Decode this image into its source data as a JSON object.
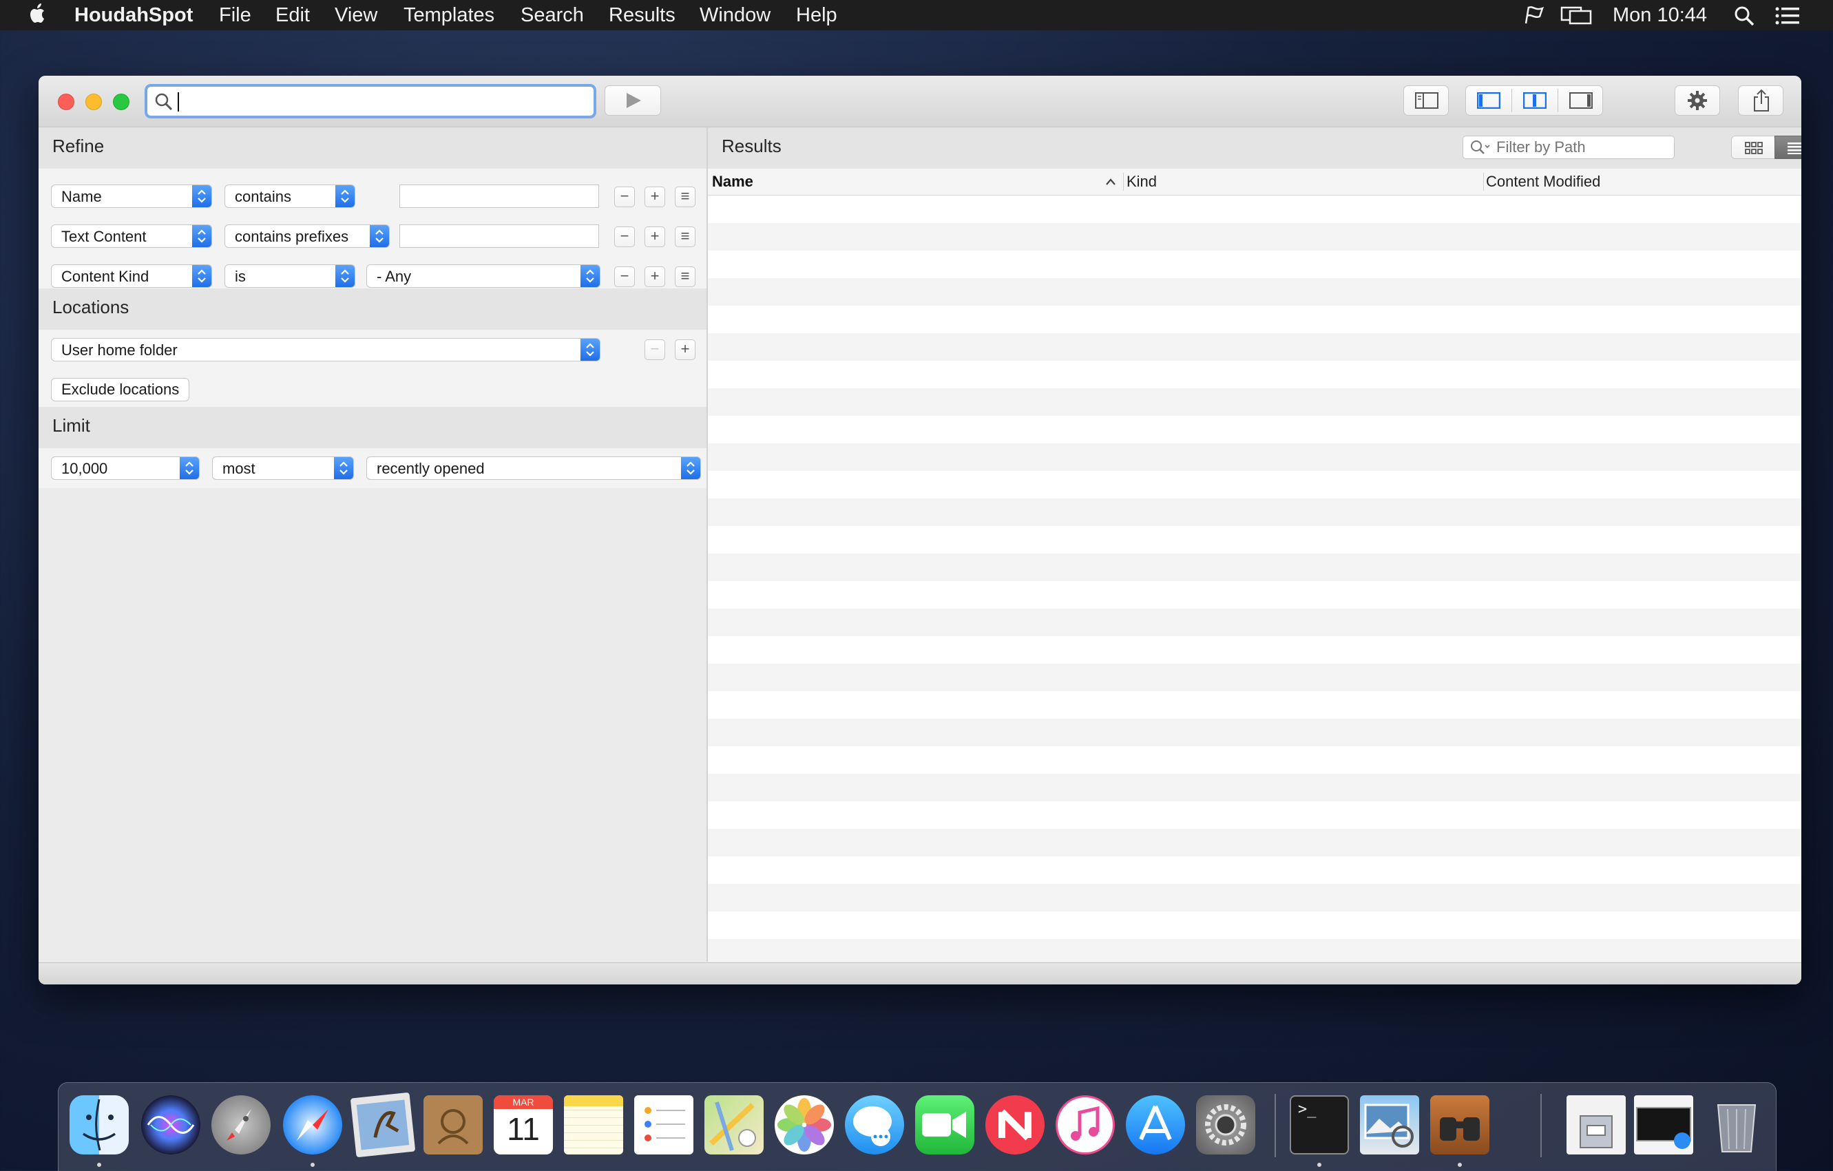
{
  "menubar": {
    "app_name": "HoudahSpot",
    "menus": [
      "File",
      "Edit",
      "View",
      "Templates",
      "Search",
      "Results",
      "Window",
      "Help"
    ],
    "clock": "Mon 10:44",
    "status_icons": [
      "flag-icon",
      "display-mirror-icon",
      "spotlight-icon",
      "notification-center-icon"
    ]
  },
  "toolbar": {
    "search_value": "",
    "buttons": [
      "play-icon",
      "sidebar-toggle-icon",
      "layout-left-icon",
      "layout-center-icon",
      "layout-right-icon",
      "gear-icon",
      "share-icon"
    ]
  },
  "refine": {
    "title": "Refine",
    "criteria": [
      {
        "attribute": "Name",
        "operator": "contains",
        "value": ""
      },
      {
        "attribute": "Text Content",
        "operator": "contains prefixes",
        "value": ""
      },
      {
        "attribute": "Content Kind",
        "operator": "is",
        "value": "- Any"
      }
    ]
  },
  "locations": {
    "title": "Locations",
    "location": "User home folder",
    "exclude_label": "Exclude locations"
  },
  "limit": {
    "title": "Limit",
    "count": "10,000",
    "order": "most",
    "criterion": "recently opened"
  },
  "results": {
    "title": "Results",
    "filter_placeholder": "Filter by Path",
    "columns": [
      "Name",
      "Kind",
      "Content Modified"
    ],
    "sorted_column": "Name",
    "sort_direction": "ascending"
  },
  "colors": {
    "accent": "#1f6fe8",
    "close": "#fc5f57",
    "minimize": "#fdbc2e",
    "zoom": "#28c840"
  },
  "dock": {
    "apps": [
      "Finder",
      "Siri",
      "Launchpad",
      "Safari",
      "Mail",
      "Contacts",
      "Calendar",
      "Notes",
      "Reminders",
      "Maps",
      "Photos",
      "Messages",
      "FaceTime",
      "News",
      "iTunes",
      "App Store",
      "System Preferences",
      "Terminal",
      "Preview",
      "HoudahSpot",
      "Archive Utility",
      "Screen Recorder",
      "Trash"
    ],
    "calendar_month": "MAR",
    "calendar_day": "11",
    "terminal_prompt": ">_"
  }
}
